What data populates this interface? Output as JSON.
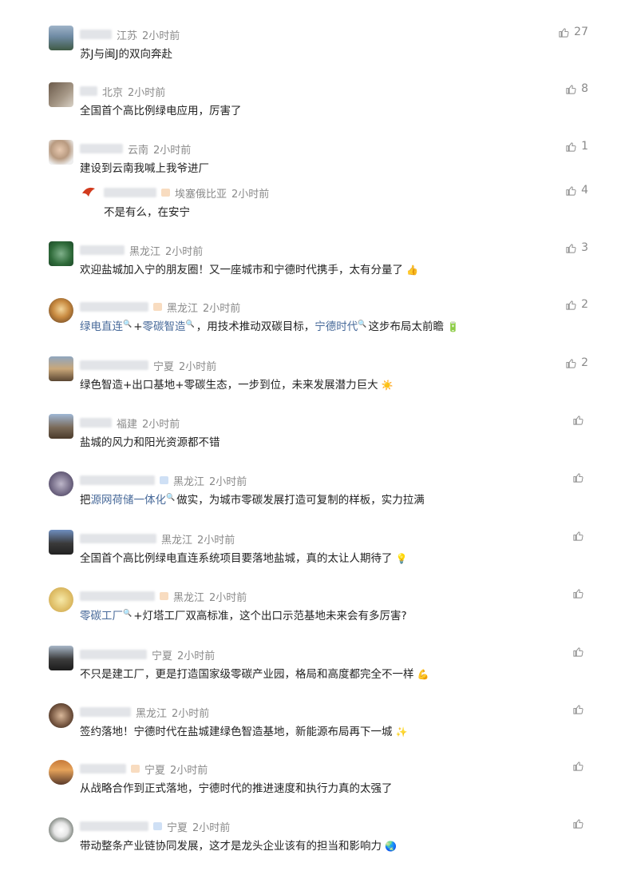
{
  "comments": [
    {
      "location": "江苏",
      "time": "2小时前",
      "text": "苏J与闽J的双向奔赴",
      "likes": "27"
    },
    {
      "location": "北京",
      "time": "2小时前",
      "text": "全国首个高比例绿电应用，厉害了",
      "likes": "8"
    },
    {
      "location": "云南",
      "time": "2小时前",
      "text": "建设到云南我喊上我爷进厂",
      "likes": "1"
    },
    {
      "location": "埃塞俄比亚",
      "time": "2小时前",
      "text": "不是有么，在安宁",
      "likes": "4"
    },
    {
      "location": "黑龙江",
      "time": "2小时前",
      "text": "欢迎盐城加入宁的朋友圈！又一座城市和宁德时代携手，太有分量了",
      "likes": "3"
    },
    {
      "location": "黑龙江",
      "time": "2小时前",
      "link1": "绿电直连",
      "plus": "+",
      "link2": "零碳智造",
      "mid": "，用技术推动双碳目标，",
      "link3": "宁德时代",
      "tail": "这步布局太前瞻",
      "likes": "2"
    },
    {
      "location": "宁夏",
      "time": "2小时前",
      "text": " 绿色智造+出口基地+零碳生态，一步到位，未来发展潜力巨大",
      "likes": "2"
    },
    {
      "location": "福建",
      "time": "2小时前",
      "text": "盐城的风力和阳光资源都不错",
      "likes": ""
    },
    {
      "location": "黑龙江",
      "time": "2小时前",
      "pre": "把",
      "link1": "源网荷储一体化",
      "tail": "做实，为城市零碳发展打造可复制的样板，实力拉满",
      "likes": ""
    },
    {
      "location": "黑龙江",
      "time": "2小时前",
      "text": "全国首个高比例绿电直连系统项目要落地盐城，真的太让人期待了",
      "likes": ""
    },
    {
      "location": "黑龙江",
      "time": "2小时前",
      "link1": " 零碳工厂",
      "tail": "+灯塔工厂双高标准，这个出口示范基地未来会有多厉害?",
      "likes": ""
    },
    {
      "location": "宁夏",
      "time": "2小时前",
      "text": "不只是建工厂，更是打造国家级零碳产业园，格局和高度都完全不一样",
      "likes": ""
    },
    {
      "location": "黑龙江",
      "time": "2小时前",
      "text": "签约落地！宁德时代在盐城建绿色智造基地，新能源布局再下一城",
      "likes": ""
    },
    {
      "location": "宁夏",
      "time": "2小时前",
      "text": "从战略合作到正式落地，宁德时代的推进速度和执行力真的太强了",
      "likes": ""
    },
    {
      "location": "宁夏",
      "time": "2小时前",
      "text": "带动整条产业链协同发展，这才是龙头企业该有的担当和影响力",
      "likes": ""
    }
  ],
  "icons": {
    "like": "thumbs-up-icon",
    "search": "search-icon"
  },
  "colors": {
    "link": "#486a9a",
    "meta": "#8a8a8a"
  }
}
